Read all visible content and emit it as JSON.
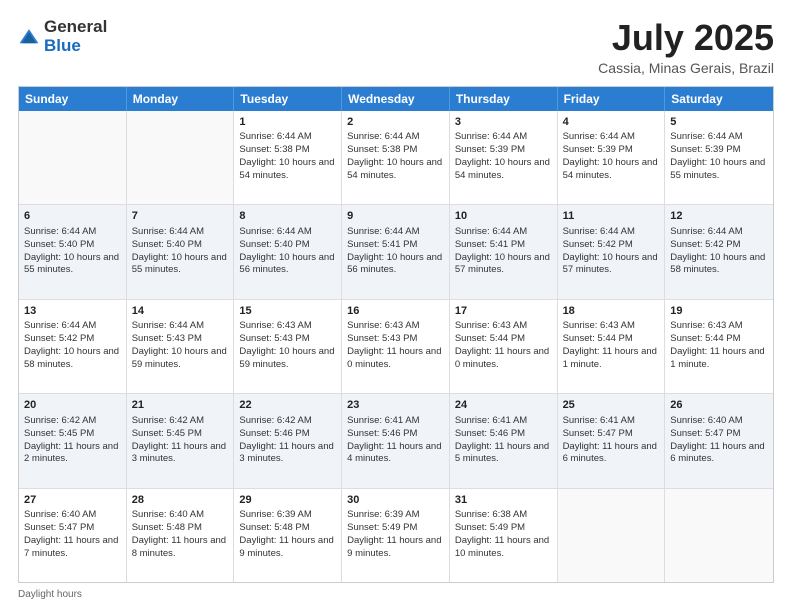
{
  "header": {
    "logo_general": "General",
    "logo_blue": "Blue",
    "main_title": "July 2025",
    "sub_title": "Cassia, Minas Gerais, Brazil"
  },
  "calendar": {
    "days_of_week": [
      "Sunday",
      "Monday",
      "Tuesday",
      "Wednesday",
      "Thursday",
      "Friday",
      "Saturday"
    ],
    "weeks": [
      [
        {
          "day": "",
          "info": "",
          "empty": true
        },
        {
          "day": "",
          "info": "",
          "empty": true
        },
        {
          "day": "1",
          "info": "Sunrise: 6:44 AM\nSunset: 5:38 PM\nDaylight: 10 hours and 54 minutes.",
          "empty": false
        },
        {
          "day": "2",
          "info": "Sunrise: 6:44 AM\nSunset: 5:38 PM\nDaylight: 10 hours and 54 minutes.",
          "empty": false
        },
        {
          "day": "3",
          "info": "Sunrise: 6:44 AM\nSunset: 5:39 PM\nDaylight: 10 hours and 54 minutes.",
          "empty": false
        },
        {
          "day": "4",
          "info": "Sunrise: 6:44 AM\nSunset: 5:39 PM\nDaylight: 10 hours and 54 minutes.",
          "empty": false
        },
        {
          "day": "5",
          "info": "Sunrise: 6:44 AM\nSunset: 5:39 PM\nDaylight: 10 hours and 55 minutes.",
          "empty": false
        }
      ],
      [
        {
          "day": "6",
          "info": "Sunrise: 6:44 AM\nSunset: 5:40 PM\nDaylight: 10 hours and 55 minutes.",
          "empty": false
        },
        {
          "day": "7",
          "info": "Sunrise: 6:44 AM\nSunset: 5:40 PM\nDaylight: 10 hours and 55 minutes.",
          "empty": false
        },
        {
          "day": "8",
          "info": "Sunrise: 6:44 AM\nSunset: 5:40 PM\nDaylight: 10 hours and 56 minutes.",
          "empty": false
        },
        {
          "day": "9",
          "info": "Sunrise: 6:44 AM\nSunset: 5:41 PM\nDaylight: 10 hours and 56 minutes.",
          "empty": false
        },
        {
          "day": "10",
          "info": "Sunrise: 6:44 AM\nSunset: 5:41 PM\nDaylight: 10 hours and 57 minutes.",
          "empty": false
        },
        {
          "day": "11",
          "info": "Sunrise: 6:44 AM\nSunset: 5:42 PM\nDaylight: 10 hours and 57 minutes.",
          "empty": false
        },
        {
          "day": "12",
          "info": "Sunrise: 6:44 AM\nSunset: 5:42 PM\nDaylight: 10 hours and 58 minutes.",
          "empty": false
        }
      ],
      [
        {
          "day": "13",
          "info": "Sunrise: 6:44 AM\nSunset: 5:42 PM\nDaylight: 10 hours and 58 minutes.",
          "empty": false
        },
        {
          "day": "14",
          "info": "Sunrise: 6:44 AM\nSunset: 5:43 PM\nDaylight: 10 hours and 59 minutes.",
          "empty": false
        },
        {
          "day": "15",
          "info": "Sunrise: 6:43 AM\nSunset: 5:43 PM\nDaylight: 10 hours and 59 minutes.",
          "empty": false
        },
        {
          "day": "16",
          "info": "Sunrise: 6:43 AM\nSunset: 5:43 PM\nDaylight: 11 hours and 0 minutes.",
          "empty": false
        },
        {
          "day": "17",
          "info": "Sunrise: 6:43 AM\nSunset: 5:44 PM\nDaylight: 11 hours and 0 minutes.",
          "empty": false
        },
        {
          "day": "18",
          "info": "Sunrise: 6:43 AM\nSunset: 5:44 PM\nDaylight: 11 hours and 1 minute.",
          "empty": false
        },
        {
          "day": "19",
          "info": "Sunrise: 6:43 AM\nSunset: 5:44 PM\nDaylight: 11 hours and 1 minute.",
          "empty": false
        }
      ],
      [
        {
          "day": "20",
          "info": "Sunrise: 6:42 AM\nSunset: 5:45 PM\nDaylight: 11 hours and 2 minutes.",
          "empty": false
        },
        {
          "day": "21",
          "info": "Sunrise: 6:42 AM\nSunset: 5:45 PM\nDaylight: 11 hours and 3 minutes.",
          "empty": false
        },
        {
          "day": "22",
          "info": "Sunrise: 6:42 AM\nSunset: 5:46 PM\nDaylight: 11 hours and 3 minutes.",
          "empty": false
        },
        {
          "day": "23",
          "info": "Sunrise: 6:41 AM\nSunset: 5:46 PM\nDaylight: 11 hours and 4 minutes.",
          "empty": false
        },
        {
          "day": "24",
          "info": "Sunrise: 6:41 AM\nSunset: 5:46 PM\nDaylight: 11 hours and 5 minutes.",
          "empty": false
        },
        {
          "day": "25",
          "info": "Sunrise: 6:41 AM\nSunset: 5:47 PM\nDaylight: 11 hours and 6 minutes.",
          "empty": false
        },
        {
          "day": "26",
          "info": "Sunrise: 6:40 AM\nSunset: 5:47 PM\nDaylight: 11 hours and 6 minutes.",
          "empty": false
        }
      ],
      [
        {
          "day": "27",
          "info": "Sunrise: 6:40 AM\nSunset: 5:47 PM\nDaylight: 11 hours and 7 minutes.",
          "empty": false
        },
        {
          "day": "28",
          "info": "Sunrise: 6:40 AM\nSunset: 5:48 PM\nDaylight: 11 hours and 8 minutes.",
          "empty": false
        },
        {
          "day": "29",
          "info": "Sunrise: 6:39 AM\nSunset: 5:48 PM\nDaylight: 11 hours and 9 minutes.",
          "empty": false
        },
        {
          "day": "30",
          "info": "Sunrise: 6:39 AM\nSunset: 5:49 PM\nDaylight: 11 hours and 9 minutes.",
          "empty": false
        },
        {
          "day": "31",
          "info": "Sunrise: 6:38 AM\nSunset: 5:49 PM\nDaylight: 11 hours and 10 minutes.",
          "empty": false
        },
        {
          "day": "",
          "info": "",
          "empty": true
        },
        {
          "day": "",
          "info": "",
          "empty": true
        }
      ]
    ]
  },
  "footer": {
    "daylight_label": "Daylight hours"
  }
}
